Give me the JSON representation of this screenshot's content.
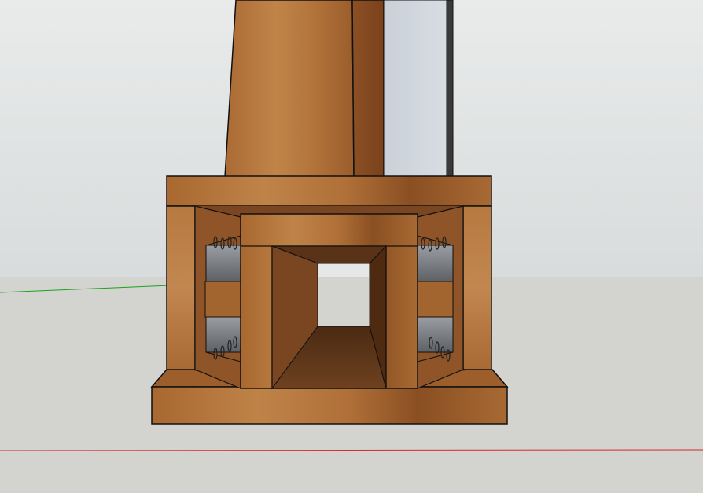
{
  "viewport": {
    "projection": "perspective",
    "background": {
      "sky_top": "#e9ebeb",
      "sky_bottom": "#d9dcdc",
      "ground": "#d3d3cf"
    },
    "axes": [
      {
        "name": "green",
        "color": "#19a31d"
      },
      {
        "name": "red",
        "color": "#d42a2a"
      }
    ],
    "materials": {
      "wood_light": "#b87a42",
      "wood_mid": "#a3652f",
      "wood_dark": "#7a4621",
      "wood_deep": "#5d3417",
      "glass": "#cfd6dd",
      "steel": "#767a7e",
      "steel_light": "#aeb2b6",
      "edge": "#111111"
    },
    "components": [
      {
        "name": "upright-post"
      },
      {
        "name": "glass-panel"
      },
      {
        "name": "top-beam"
      },
      {
        "name": "left-side-block"
      },
      {
        "name": "right-side-block"
      },
      {
        "name": "center-box-beam"
      },
      {
        "name": "base-plate"
      },
      {
        "name": "left-upper-bracket"
      },
      {
        "name": "left-lower-bracket"
      },
      {
        "name": "right-upper-bracket"
      },
      {
        "name": "right-lower-bracket"
      }
    ]
  }
}
